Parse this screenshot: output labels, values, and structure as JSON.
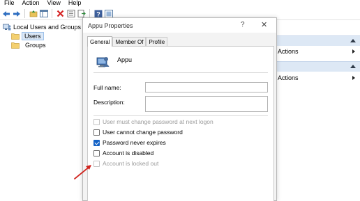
{
  "menu": [
    "File",
    "Action",
    "View",
    "Help"
  ],
  "toolbar_icons": [
    "back-arrow-icon",
    "forward-arrow-icon",
    "up-folder-icon",
    "show-hide-tree-icon",
    "delete-icon",
    "properties-icon",
    "export-list-icon",
    "help-icon",
    "snapin-icon"
  ],
  "tree": {
    "root": "Local Users and Groups (Lo",
    "children": [
      "Users",
      "Groups"
    ],
    "selected": "Users"
  },
  "actions_pane": {
    "items": [
      {
        "label": "Actions"
      },
      {
        "label": "Actions"
      }
    ]
  },
  "dialog": {
    "title": "Appu Properties",
    "help": "?",
    "close": "✕",
    "tabs": [
      "General",
      "Member Of",
      "Profile"
    ],
    "active_tab": "General",
    "username": "Appu",
    "full_name_label": "Full name:",
    "full_name_value": "",
    "description_label": "Description:",
    "description_value": "",
    "checkboxes": [
      {
        "label": "User must change password at next logon",
        "checked": false,
        "disabled": true
      },
      {
        "label": "User cannot change password",
        "checked": false,
        "disabled": false
      },
      {
        "label": "Password never expires",
        "checked": true,
        "disabled": false
      },
      {
        "label": "Account is disabled",
        "checked": false,
        "disabled": false
      },
      {
        "label": "Account is locked out",
        "checked": false,
        "disabled": true
      }
    ]
  },
  "colors": {
    "accent": "#1463c7",
    "annotation_arrow": "#d0231d",
    "actions_header": "#dde8f5"
  }
}
